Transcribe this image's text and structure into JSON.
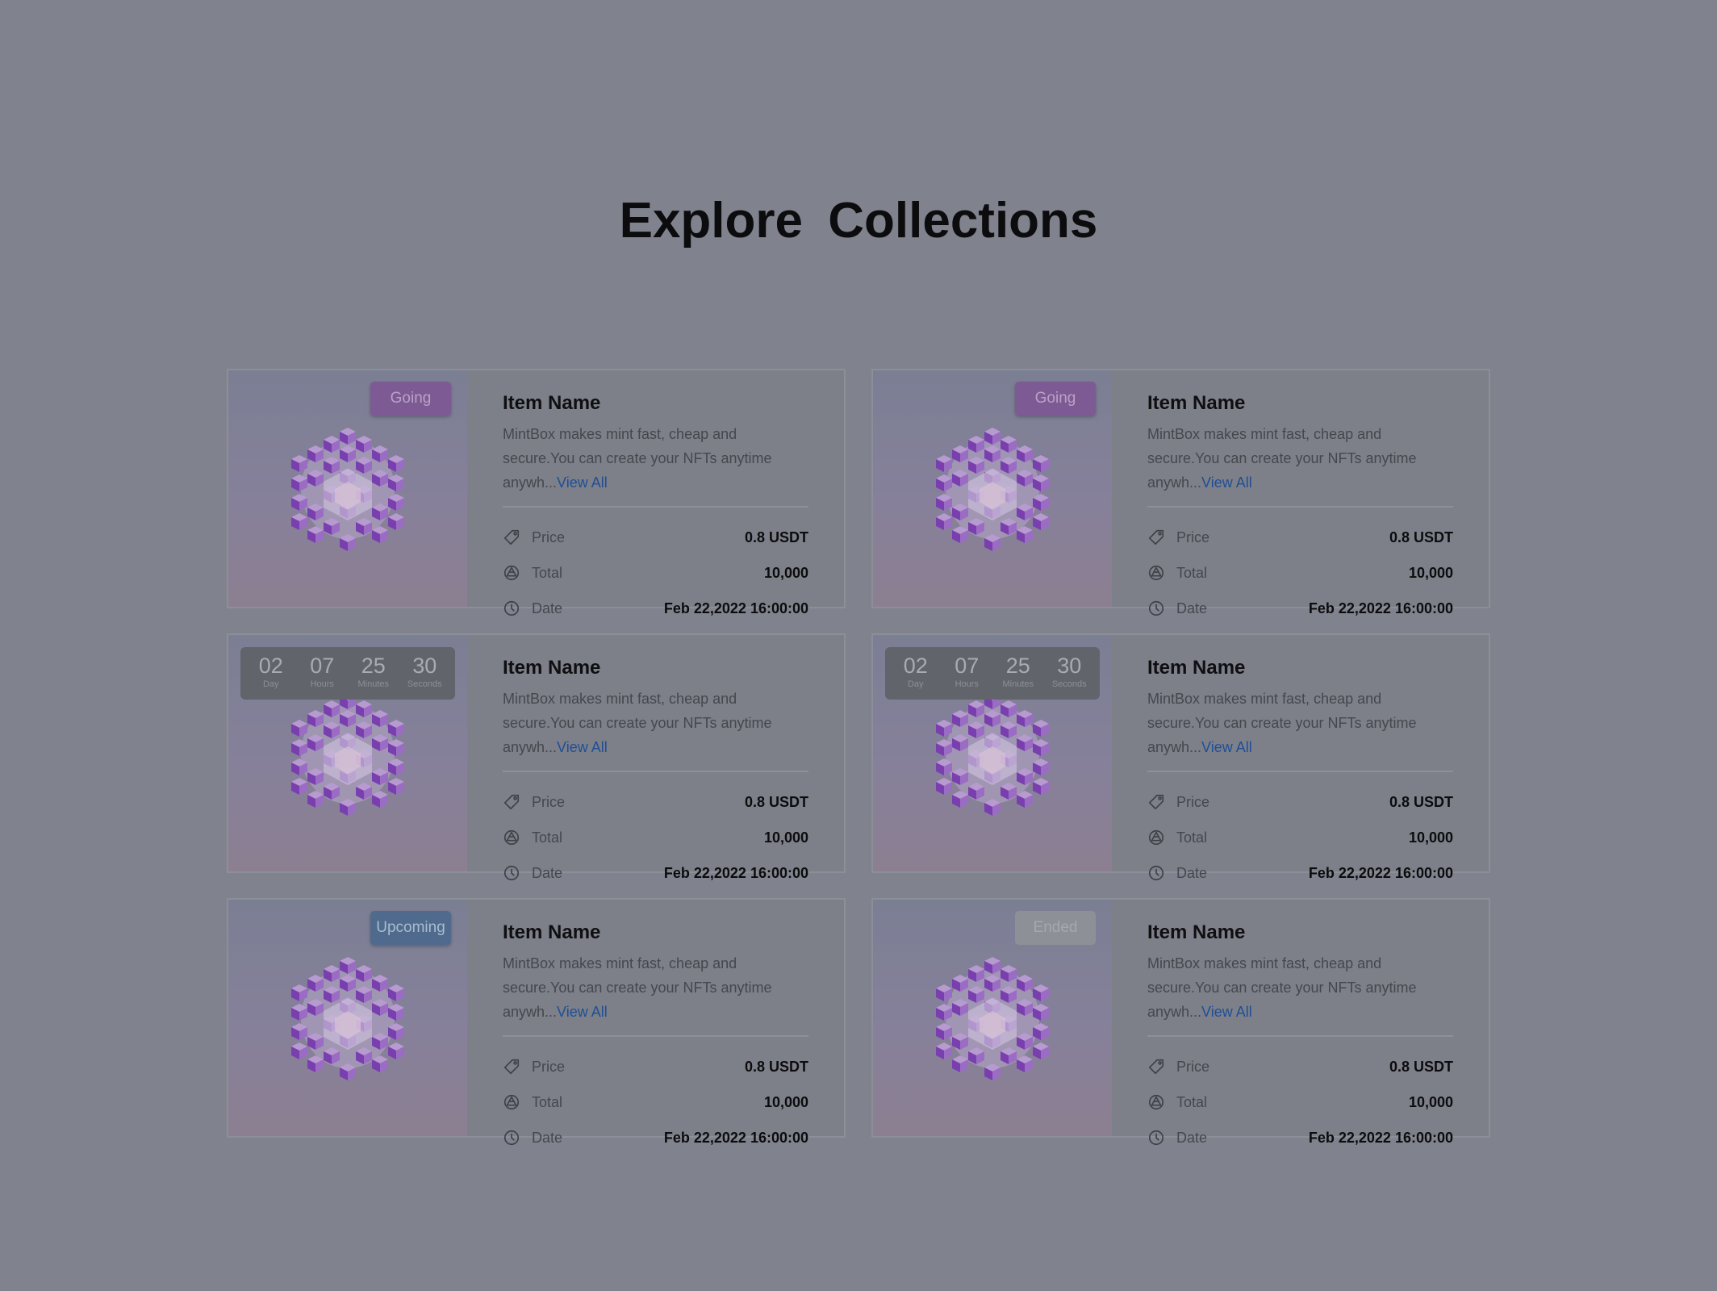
{
  "page": {
    "title": "Explore  Collections"
  },
  "colors": {
    "background": "#80838d",
    "going": "#7e5a94",
    "upcoming": "#4f6a8c",
    "ended": "#8e9097",
    "link": "#1f4e96"
  },
  "cards": [
    {
      "status": {
        "type": "badge",
        "label": "Going"
      },
      "name": "Item Name",
      "description": "MintBox makes mint fast, cheap and secure.You can create your NFTs anytime anywh...",
      "view_all": "View All",
      "price_label": "Price",
      "price": "0.8 USDT",
      "total_label": "Total",
      "total": "10,000",
      "date_label": "Date",
      "date": "Feb 22,2022 16:00:00"
    },
    {
      "status": {
        "type": "badge",
        "label": "Going"
      },
      "name": "Item Name",
      "description": "MintBox makes mint fast, cheap and secure.You can create your NFTs anytime anywh...",
      "view_all": "View All",
      "price_label": "Price",
      "price": "0.8 USDT",
      "total_label": "Total",
      "total": "10,000",
      "date_label": "Date",
      "date": "Feb 22,2022 16:00:00"
    },
    {
      "status": {
        "type": "countdown",
        "day": "02",
        "day_label": "Day",
        "hours": "07",
        "hours_label": "Hours",
        "minutes": "25",
        "minutes_label": "Minutes",
        "seconds": "30",
        "seconds_label": "Seconds"
      },
      "name": "Item Name",
      "description": "MintBox makes mint fast, cheap and secure.You can create your NFTs anytime anywh...",
      "view_all": "View All",
      "price_label": "Price",
      "price": "0.8 USDT",
      "total_label": "Total",
      "total": "10,000",
      "date_label": "Date",
      "date": "Feb 22,2022 16:00:00"
    },
    {
      "status": {
        "type": "countdown",
        "day": "02",
        "day_label": "Day",
        "hours": "07",
        "hours_label": "Hours",
        "minutes": "25",
        "minutes_label": "Minutes",
        "seconds": "30",
        "seconds_label": "Seconds"
      },
      "name": "Item Name",
      "description": "MintBox makes mint fast, cheap and secure.You can create your NFTs anytime anywh...",
      "view_all": "View All",
      "price_label": "Price",
      "price": "0.8 USDT",
      "total_label": "Total",
      "total": "10,000",
      "date_label": "Date",
      "date": "Feb 22,2022 16:00:00"
    },
    {
      "status": {
        "type": "badge",
        "label": "Upcoming"
      },
      "name": "Item Name",
      "description": "MintBox makes mint fast, cheap and secure.You can create your NFTs anytime anywh...",
      "view_all": "View All",
      "price_label": "Price",
      "price": "0.8 USDT",
      "total_label": "Total",
      "total": "10,000",
      "date_label": "Date",
      "date": "Feb 22,2022 16:00:00"
    },
    {
      "status": {
        "type": "badge",
        "label": "Ended"
      },
      "name": "Item Name",
      "description": "MintBox makes mint fast, cheap and secure.You can create your NFTs anytime anywh...",
      "view_all": "View All",
      "price_label": "Price",
      "price": "0.8 USDT",
      "total_label": "Total",
      "total": "10,000",
      "date_label": "Date",
      "date": "Feb 22,2022 16:00:00"
    }
  ]
}
